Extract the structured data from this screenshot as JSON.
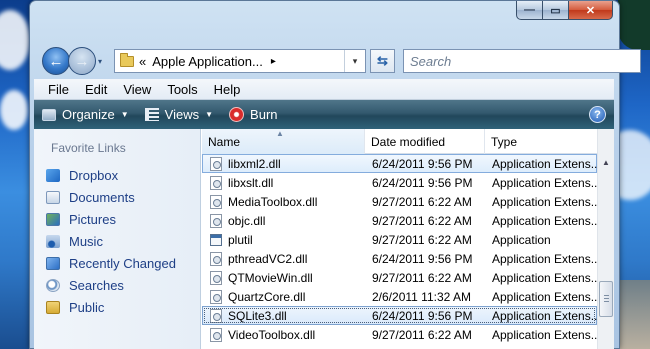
{
  "window": {
    "buttons": {
      "minimize": "—",
      "maximize": "▭",
      "close": "✕"
    }
  },
  "navigation": {
    "back_icon": "←",
    "forward_icon": "→",
    "dropdown_icon": "▾"
  },
  "address_bar": {
    "prefix": "«",
    "path": "Apple Application...",
    "chevron": "▸",
    "dropdown_icon": "▾",
    "refresh_icon": "⇆"
  },
  "search": {
    "placeholder": "Search"
  },
  "menu": [
    "File",
    "Edit",
    "View",
    "Tools",
    "Help"
  ],
  "commands": {
    "organize": "Organize",
    "views": "Views",
    "burn": "Burn",
    "help": "?"
  },
  "favorites": {
    "title": "Favorite Links",
    "items": [
      "Dropbox",
      "Documents",
      "Pictures",
      "Music",
      "Recently Changed",
      "Searches",
      "Public"
    ]
  },
  "columns": {
    "name": "Name",
    "date": "Date modified",
    "type": "Type",
    "sort_indicator": "▲"
  },
  "files": [
    {
      "name": "libxml2.dll",
      "date": "6/24/2011 9:56 PM",
      "type": "Application Extens...",
      "icon": "dll-icon"
    },
    {
      "name": "libxslt.dll",
      "date": "6/24/2011 9:56 PM",
      "type": "Application Extens...",
      "icon": "dll-icon"
    },
    {
      "name": "MediaToolbox.dll",
      "date": "9/27/2011 6:22 AM",
      "type": "Application Extens...",
      "icon": "dll-icon"
    },
    {
      "name": "objc.dll",
      "date": "9/27/2011 6:22 AM",
      "type": "Application Extens...",
      "icon": "dll-icon"
    },
    {
      "name": "plutil",
      "date": "9/27/2011 6:22 AM",
      "type": "Application",
      "icon": "application-icon"
    },
    {
      "name": "pthreadVC2.dll",
      "date": "6/24/2011 9:56 PM",
      "type": "Application Extens...",
      "icon": "dll-icon"
    },
    {
      "name": "QTMovieWin.dll",
      "date": "9/27/2011 6:22 AM",
      "type": "Application Extens...",
      "icon": "dll-icon"
    },
    {
      "name": "QuartzCore.dll",
      "date": "2/6/2011 11:32 AM",
      "type": "Application Extens...",
      "icon": "dll-icon"
    },
    {
      "name": "SQLite3.dll",
      "date": "6/24/2011 9:56 PM",
      "type": "Application Extens...",
      "icon": "dll-icon"
    },
    {
      "name": "VideoToolbox.dll",
      "date": "9/27/2011 6:22 AM",
      "type": "Application Extens...",
      "icon": "dll-icon"
    }
  ],
  "scrollbar": {
    "up_arrow": "▲"
  }
}
